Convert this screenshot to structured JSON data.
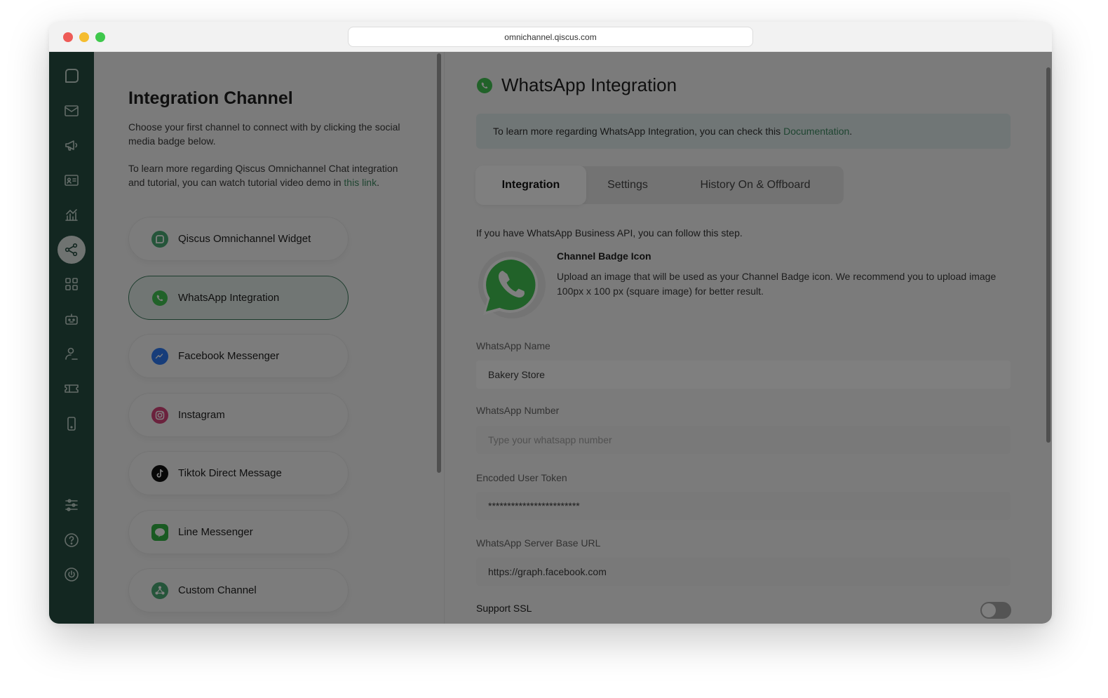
{
  "browser": {
    "url": "omnichannel.qiscus.com"
  },
  "sidebar": {
    "items": [
      {
        "icon": "chat-bubble-icon"
      },
      {
        "icon": "inbox-icon"
      },
      {
        "icon": "megaphone-icon"
      },
      {
        "icon": "contact-card-icon"
      },
      {
        "icon": "analytics-icon"
      },
      {
        "icon": "integration-share-icon",
        "active": true
      },
      {
        "icon": "apps-grid-icon"
      },
      {
        "icon": "bot-icon"
      },
      {
        "icon": "agent-icon"
      },
      {
        "icon": "ticket-icon"
      },
      {
        "icon": "mobile-icon"
      },
      {
        "icon": "settings-sliders-icon"
      },
      {
        "icon": "help-icon"
      },
      {
        "icon": "power-icon"
      }
    ]
  },
  "left": {
    "title": "Integration Channel",
    "intro": "Choose your first channel to connect with by clicking the social media badge below.",
    "tutorial_text": "To learn more regarding Qiscus Omnichannel Chat integration and tutorial, you can watch tutorial video demo in",
    "tutorial_link": "this link",
    "tutorial_end": ".",
    "channels": [
      {
        "label": "Qiscus Omnichannel Widget",
        "icon": "qiscus-widget-icon"
      },
      {
        "label": "WhatsApp Integration",
        "icon": "whatsapp-icon",
        "selected": true
      },
      {
        "label": "Facebook Messenger",
        "icon": "messenger-icon"
      },
      {
        "label": "Instagram",
        "icon": "instagram-icon"
      },
      {
        "label": "Tiktok Direct Message",
        "icon": "tiktok-icon"
      },
      {
        "label": "Line Messenger",
        "icon": "line-icon"
      },
      {
        "label": "Custom Channel",
        "icon": "custom-channel-icon"
      }
    ]
  },
  "right": {
    "title": "WhatsApp Integration",
    "info_text": "To learn more regarding WhatsApp Integration, you can check this",
    "info_link": "Documentation",
    "info_end": ".",
    "tabs": [
      {
        "label": "Integration",
        "active": true
      },
      {
        "label": "Settings"
      },
      {
        "label": "History On & Offboard"
      }
    ],
    "step_text": "If you have WhatsApp Business API, you can follow this step.",
    "badge": {
      "title": "Channel Badge Icon",
      "description": "Upload an image that will be used as your Channel Badge icon. We recommend you to upload image 100px x 100 px (square image) for better result."
    },
    "fields": {
      "name": {
        "label": "WhatsApp Name",
        "value": "Bakery Store"
      },
      "number": {
        "label": "WhatsApp Number",
        "placeholder": "Type your whatsapp number",
        "value": ""
      },
      "token": {
        "label": "Encoded User Token",
        "value": "************************"
      },
      "server_url": {
        "label": "WhatsApp Server Base URL",
        "value": "https://graph.facebook.com"
      }
    },
    "ssl": {
      "label": "Support SSL",
      "enabled": false
    }
  },
  "colors": {
    "sidebar": "#274e43",
    "accent": "#3e8b63",
    "whatsapp": "#43c553",
    "overlay": "rgba(0,0,0,0.5)"
  }
}
